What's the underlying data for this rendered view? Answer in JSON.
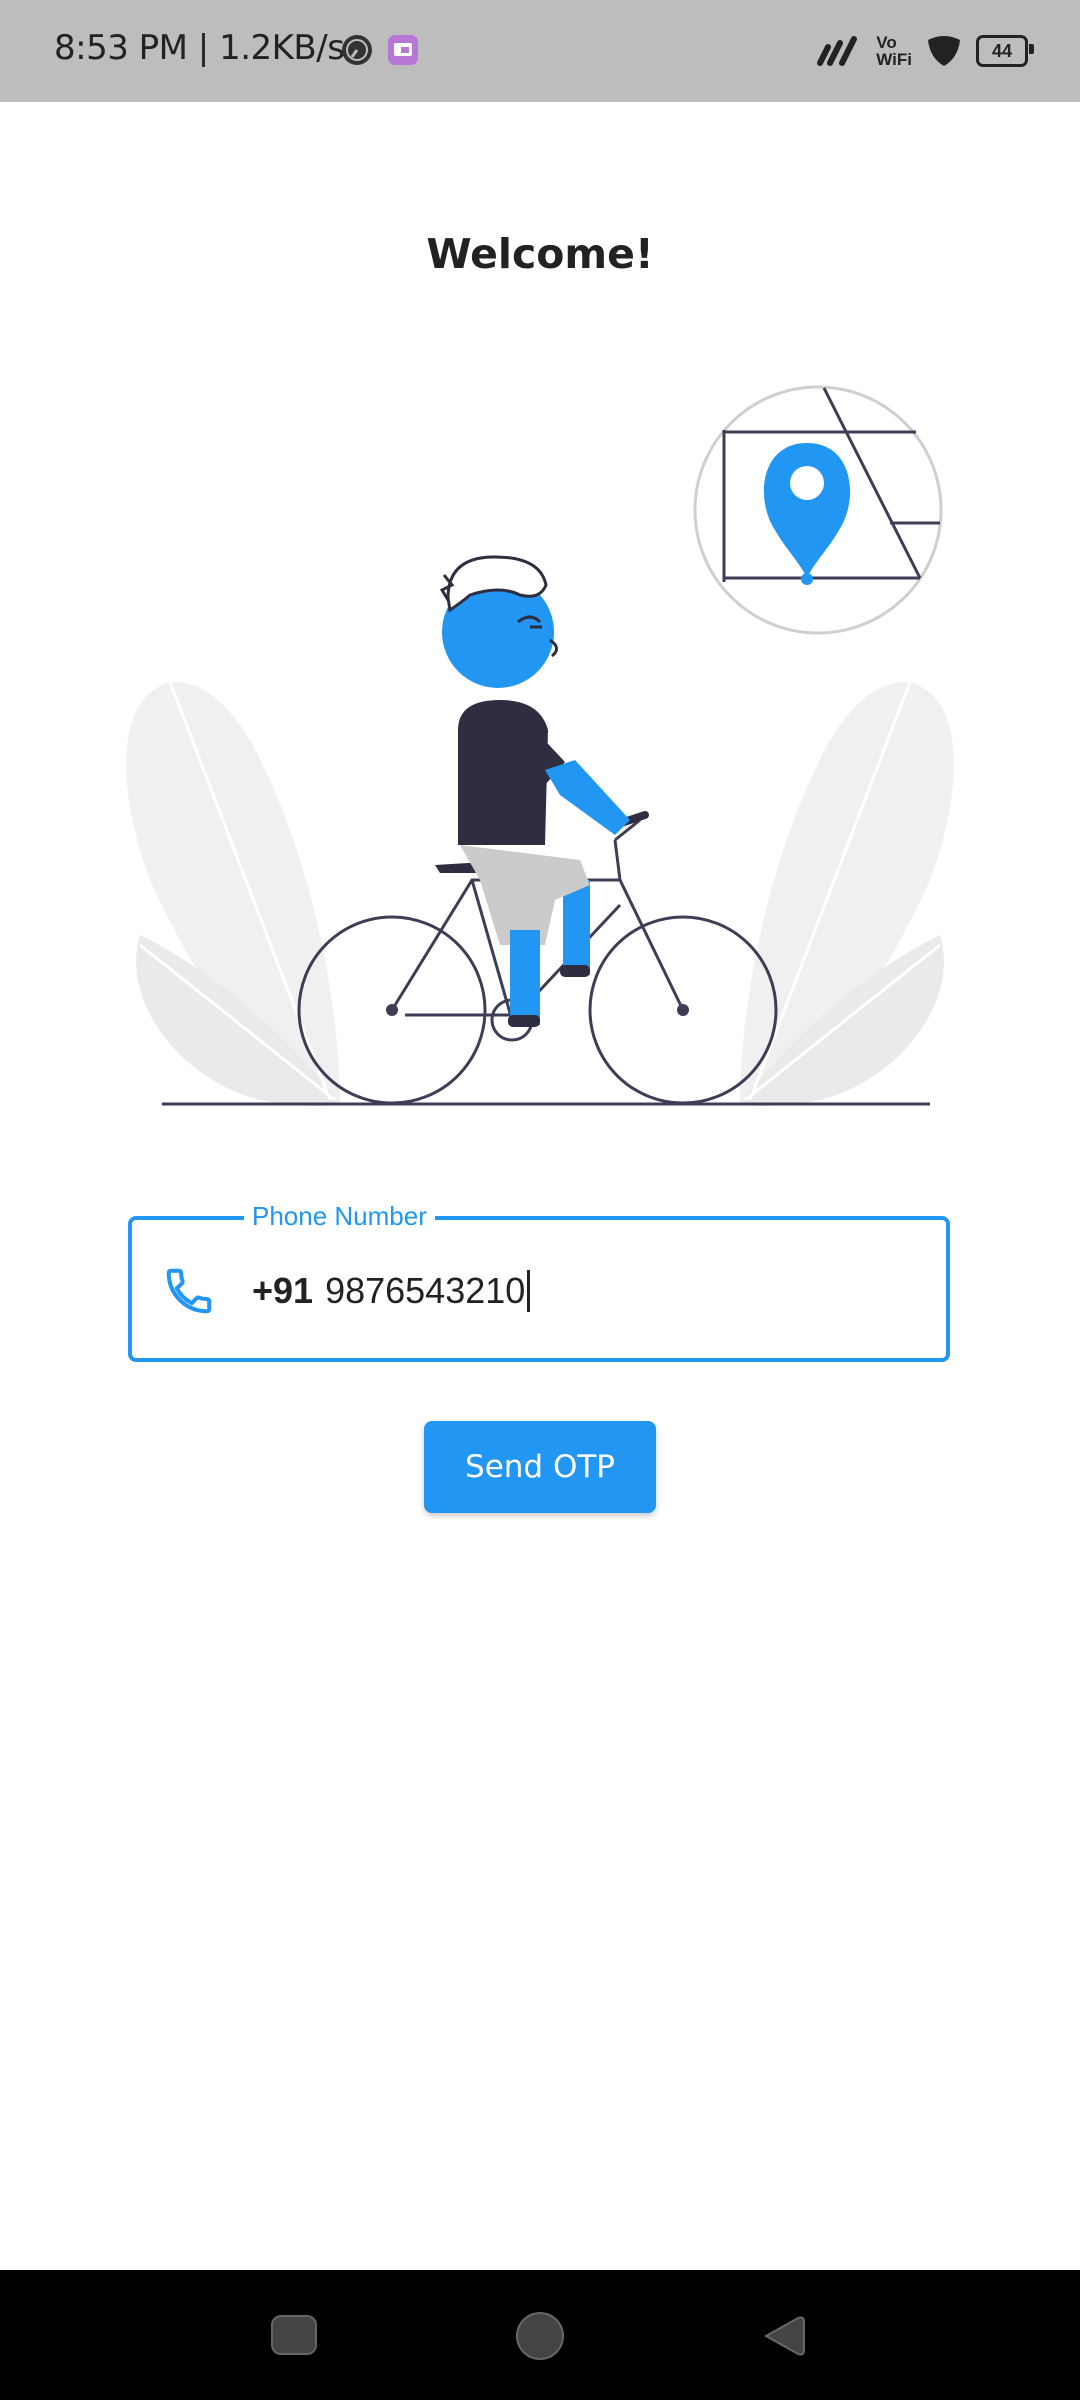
{
  "status_bar": {
    "time_speed": "8:53 PM | 1.2KB/s",
    "network": "Vo\nWiFi",
    "battery": "44",
    "icons": [
      "speed-gauge-icon",
      "app-notification-icon",
      "signal-icon",
      "vowifi-icon",
      "shield-icon",
      "battery-icon"
    ]
  },
  "page": {
    "title": "Welcome!",
    "illustration": "cyclist-with-location-pin"
  },
  "phone_field": {
    "label": "Phone Number",
    "prefix": "+91",
    "value": "9876543210",
    "icon": "phone-icon"
  },
  "actions": {
    "send_otp_label": "Send OTP"
  },
  "colors": {
    "primary": "#2196f3",
    "status_bar_bg": "#bdbdbd",
    "text": "#222222",
    "nav_bar_bg": "#000000"
  },
  "nav_bar": {
    "items": [
      "recent-apps-button",
      "home-button",
      "back-button"
    ]
  }
}
